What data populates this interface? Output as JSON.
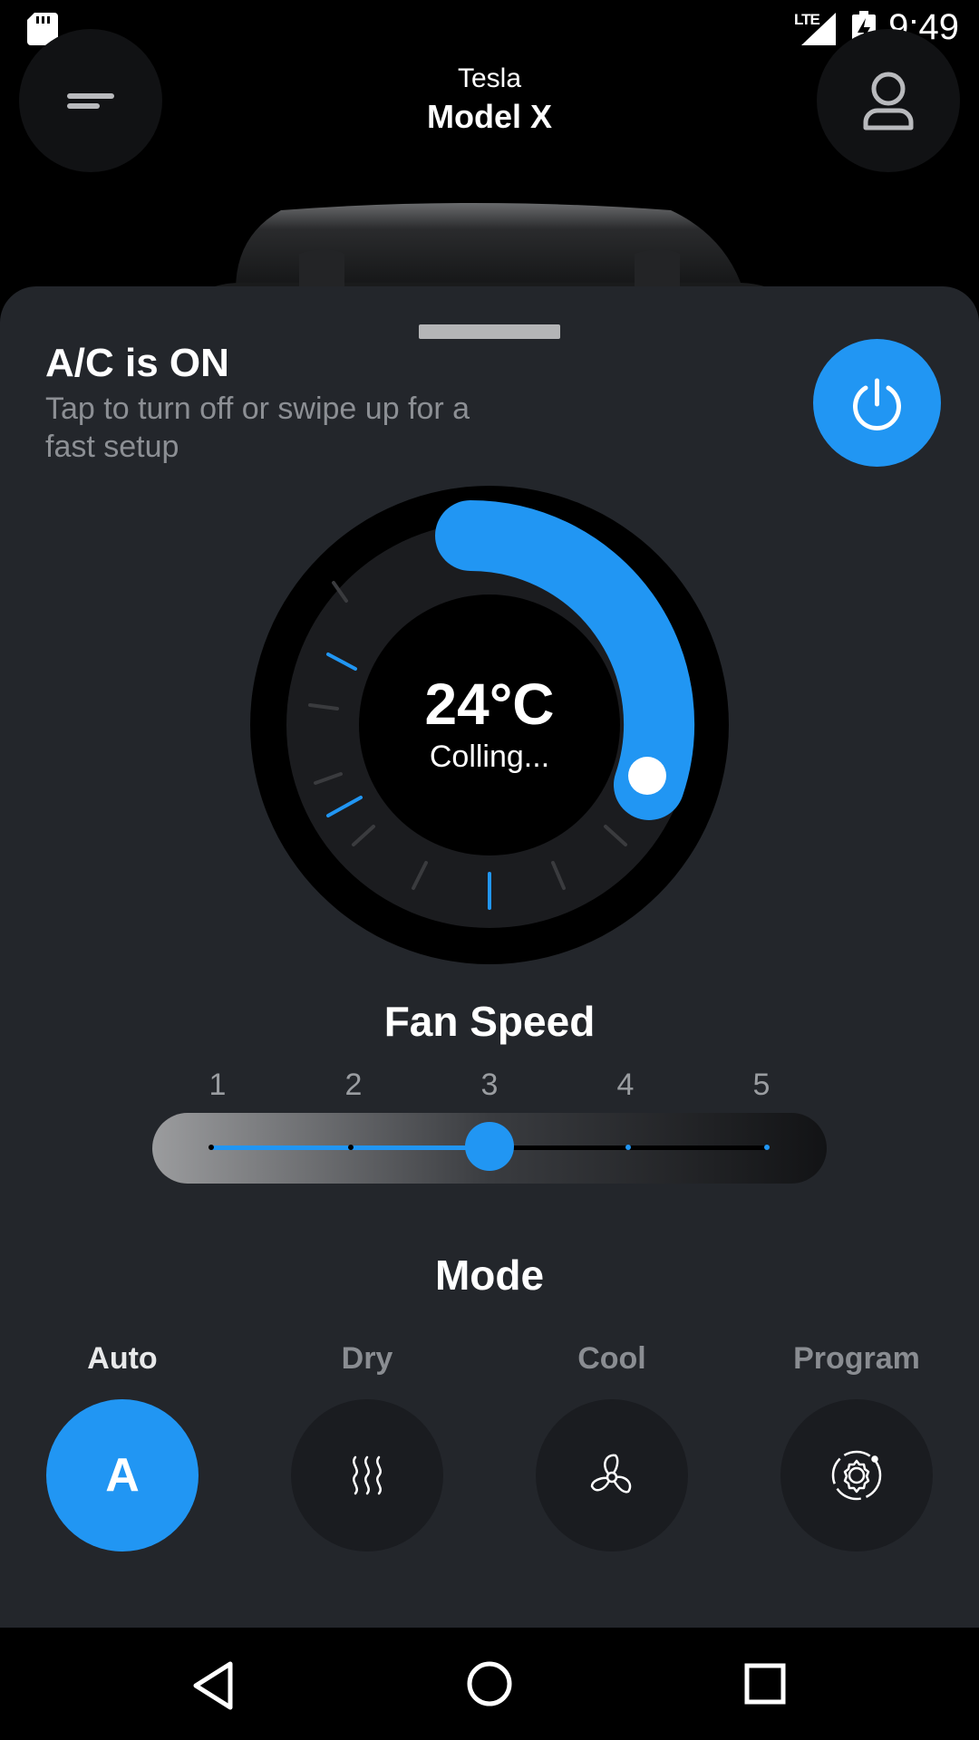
{
  "status_bar": {
    "time": "9:49",
    "network": "LTE",
    "icons": [
      "sd-card-icon",
      "signal-icon",
      "battery-charging-icon"
    ]
  },
  "header": {
    "brand": "Tesla",
    "model": "Model X",
    "menu_icon": "menu-icon",
    "profile_icon": "profile-icon"
  },
  "ac": {
    "title": "A/C is ON",
    "subtitle": "Tap to turn off or swipe up for a fast setup",
    "power_icon": "power-icon"
  },
  "thermostat": {
    "temperature": "24°C",
    "status": "Colling..."
  },
  "fan_speed": {
    "title": "Fan Speed",
    "levels": [
      "1",
      "2",
      "3",
      "4",
      "5"
    ],
    "selected_level": 3
  },
  "mode": {
    "title": "Mode",
    "options": [
      {
        "label": "Auto",
        "glyph": "A",
        "icon": "auto-icon",
        "active": true
      },
      {
        "label": "Dry",
        "icon": "dry-icon",
        "active": false
      },
      {
        "label": "Cool",
        "icon": "fan-icon",
        "active": false
      },
      {
        "label": "Program",
        "icon": "program-gear-icon",
        "active": false
      }
    ]
  },
  "colors": {
    "accent": "#2196f3",
    "sheet": "#23262b",
    "background": "#000000"
  },
  "navigation_bar": [
    "back-icon",
    "home-icon",
    "recents-icon"
  ]
}
